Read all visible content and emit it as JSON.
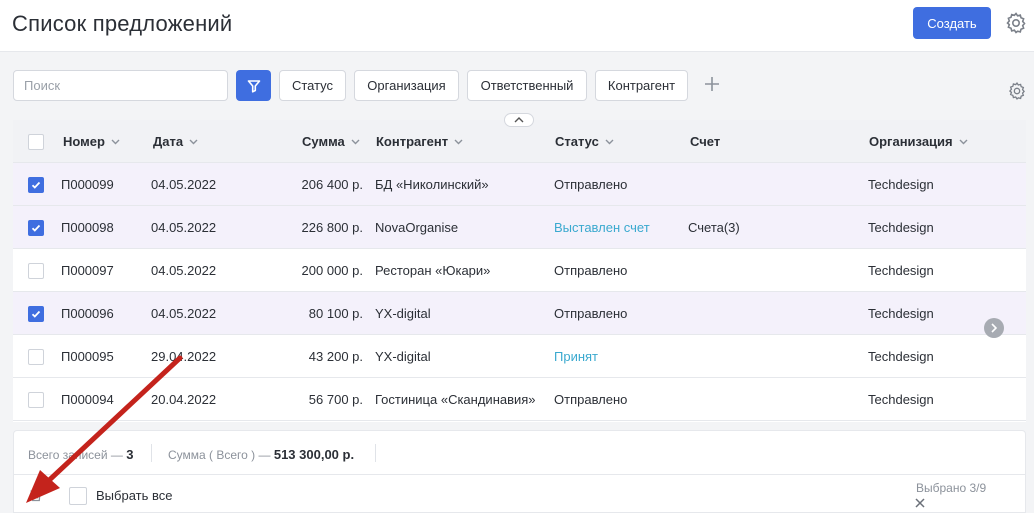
{
  "header": {
    "title": "Список предложений",
    "create_label": "Создать"
  },
  "filters": {
    "search_placeholder": "Поиск",
    "chips": [
      "Статус",
      "Организация",
      "Ответственный",
      "Контрагент"
    ]
  },
  "table": {
    "columns": [
      "Номер",
      "Дата",
      "Сумма",
      "Контрагент",
      "Статус",
      "Счет",
      "Организация"
    ],
    "rows": [
      {
        "checked": true,
        "number": "П000099",
        "date": "04.05.2022",
        "sum": "206 400 р.",
        "counterparty": "БД «Николинский»",
        "status": "Отправлено",
        "status_link": false,
        "invoice": "",
        "org": "Techdesign"
      },
      {
        "checked": true,
        "number": "П000098",
        "date": "04.05.2022",
        "sum": "226 800 р.",
        "counterparty": "NovaOrganise",
        "status": "Выставлен счет",
        "status_link": true,
        "invoice": "Счета(3)",
        "org": "Techdesign"
      },
      {
        "checked": false,
        "number": "П000097",
        "date": "04.05.2022",
        "sum": "200 000 р.",
        "counterparty": "Ресторан «Юкари»",
        "status": "Отправлено",
        "status_link": false,
        "invoice": "",
        "org": "Techdesign"
      },
      {
        "checked": true,
        "number": "П000096",
        "date": "04.05.2022",
        "sum": "80 100 р.",
        "counterparty": "YX-digital",
        "status": "Отправлено",
        "status_link": false,
        "invoice": "",
        "org": "Techdesign"
      },
      {
        "checked": false,
        "number": "П000095",
        "date": "29.04.2022",
        "sum": "43 200 р.",
        "counterparty": "YX-digital",
        "status": "Принят",
        "status_link": true,
        "invoice": "",
        "org": "Techdesign"
      },
      {
        "checked": false,
        "number": "П000094",
        "date": "20.04.2022",
        "sum": "56 700 р.",
        "counterparty": "Гостиница «Скандинавия»",
        "status": "Отправлено",
        "status_link": false,
        "invoice": "",
        "org": "Techdesign"
      }
    ]
  },
  "summary": {
    "total_label": "Всего записей —",
    "total_value": "3",
    "sum_label": "Сумма ( Всего ) —",
    "sum_value": "513 300,00 р."
  },
  "actions": {
    "select_all_label": "Выбрать все",
    "selected_count": "Выбрано 3/9"
  },
  "colors": {
    "accent": "#3f6ee0",
    "link": "#3aa9cf",
    "selected_row": "#f4f1fb",
    "annotation_arrow": "#c4231c"
  },
  "icons": [
    "gear-icon",
    "filter-icon",
    "plus-icon",
    "chevron-down-icon",
    "chevron-up-icon",
    "chevron-right-icon",
    "check-icon",
    "trash-icon",
    "close-icon"
  ]
}
